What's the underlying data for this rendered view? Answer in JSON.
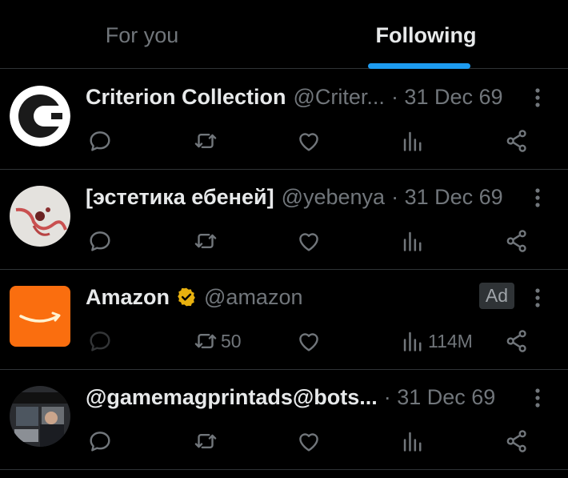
{
  "tabs": [
    {
      "label": "For you",
      "active": false
    },
    {
      "label": "Following",
      "active": true
    }
  ],
  "colors": {
    "accent": "#1d9bf0",
    "muted": "#71767b",
    "text": "#e7e9ea",
    "verified_gold": "#e8b10f",
    "amazon_orange": "#fa6e0f"
  },
  "posts": [
    {
      "name": "Criterion Collection",
      "handle": "@Criter...",
      "time": "· 31 Dec 69",
      "avatar_icon": "criterion-logo-icon"
    },
    {
      "name": "[эстетика ебеней]",
      "handle": "@yebenya",
      "time": "· 31 Dec 69",
      "avatar_icon": "artwork-avatar"
    },
    {
      "name": "Amazon",
      "handle": "@amazon",
      "ad_label": "Ad",
      "verified": true,
      "retweets": "50",
      "views": "114M",
      "avatar_icon": "amazon-logo-icon"
    },
    {
      "name": "@gamemagprintads@bots...",
      "time": "· 31 Dec 69",
      "avatar_icon": "photo-avatar"
    }
  ]
}
